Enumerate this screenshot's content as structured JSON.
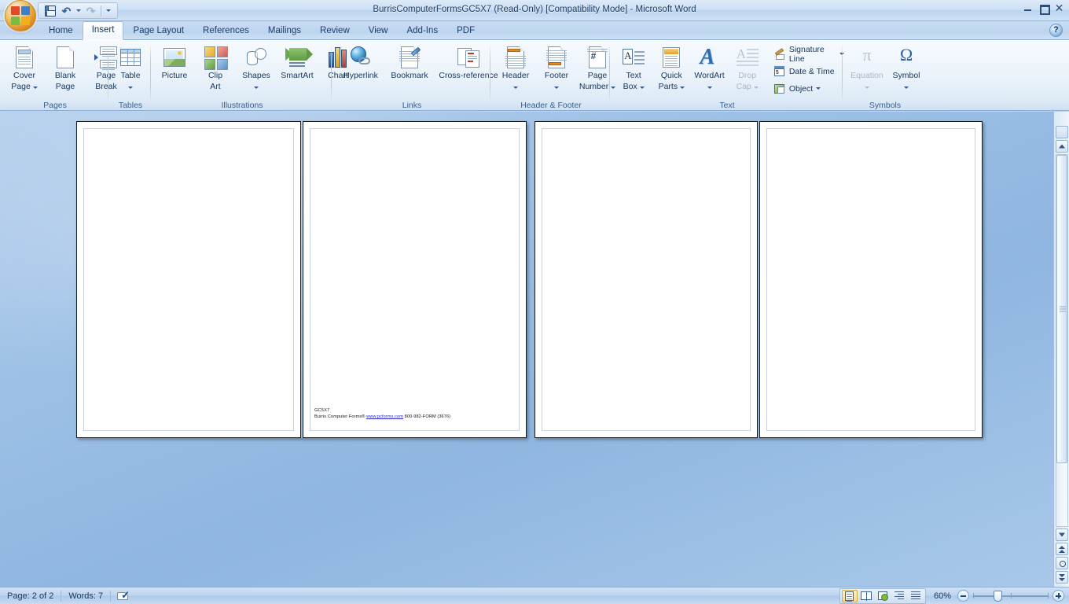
{
  "window": {
    "title": "BurrisComputerFormsGC5X7 (Read-Only) [Compatibility Mode] - Microsoft Word",
    "minimize": "Minimize",
    "maximize": "Restore Down",
    "close": "Close"
  },
  "quick_access": {
    "office_button": "Office Button",
    "save": "Save",
    "undo": "Undo",
    "redo": "Redo",
    "customize": "Customize Quick Access Toolbar"
  },
  "tabs": [
    {
      "label": "Home",
      "active": false
    },
    {
      "label": "Insert",
      "active": true
    },
    {
      "label": "Page Layout",
      "active": false
    },
    {
      "label": "References",
      "active": false
    },
    {
      "label": "Mailings",
      "active": false
    },
    {
      "label": "Review",
      "active": false
    },
    {
      "label": "View",
      "active": false
    },
    {
      "label": "Add-Ins",
      "active": false
    },
    {
      "label": "PDF",
      "active": false
    }
  ],
  "help": {
    "label": "?"
  },
  "ribbon": {
    "groups": [
      {
        "name": "Pages",
        "label": "Pages",
        "buttons": [
          {
            "label": "Cover\nPage",
            "line1": "Cover",
            "line2": "Page",
            "dropdown": true,
            "disabled": false
          },
          {
            "label": "Blank\nPage",
            "line1": "Blank",
            "line2": "Page",
            "dropdown": false,
            "disabled": false
          },
          {
            "label": "Page\nBreak",
            "line1": "Page",
            "line2": "Break",
            "dropdown": false,
            "disabled": false
          }
        ]
      },
      {
        "name": "Tables",
        "label": "Tables",
        "buttons": [
          {
            "label": "Table",
            "line1": "Table",
            "line2": "",
            "dropdown": true,
            "disabled": false
          }
        ]
      },
      {
        "name": "Illustrations",
        "label": "Illustrations",
        "buttons": [
          {
            "label": "Picture",
            "line1": "Picture",
            "line2": "",
            "dropdown": false,
            "disabled": false
          },
          {
            "label": "Clip Art",
            "line1": "Clip",
            "line2": "Art",
            "dropdown": false,
            "disabled": false
          },
          {
            "label": "Shapes",
            "line1": "Shapes",
            "line2": "",
            "dropdown": true,
            "disabled": false
          },
          {
            "label": "SmartArt",
            "line1": "SmartArt",
            "line2": "",
            "dropdown": false,
            "disabled": false
          },
          {
            "label": "Chart",
            "line1": "Chart",
            "line2": "",
            "dropdown": false,
            "disabled": false
          }
        ]
      },
      {
        "name": "Links",
        "label": "Links",
        "buttons": [
          {
            "label": "Hyperlink",
            "line1": "Hyperlink",
            "line2": "",
            "dropdown": false,
            "disabled": false
          },
          {
            "label": "Bookmark",
            "line1": "Bookmark",
            "line2": "",
            "dropdown": false,
            "disabled": false
          },
          {
            "label": "Cross-reference",
            "line1": "Cross-reference",
            "line2": "",
            "dropdown": false,
            "disabled": false
          }
        ]
      },
      {
        "name": "Header & Footer",
        "label": "Header & Footer",
        "buttons": [
          {
            "label": "Header",
            "line1": "Header",
            "line2": "",
            "dropdown": true,
            "disabled": false
          },
          {
            "label": "Footer",
            "line1": "Footer",
            "line2": "",
            "dropdown": true,
            "disabled": false
          },
          {
            "label": "Page Number",
            "line1": "Page",
            "line2": "Number",
            "dropdown": true,
            "disabled": false
          }
        ]
      },
      {
        "name": "Text",
        "label": "Text",
        "buttons": [
          {
            "label": "Text Box",
            "line1": "Text",
            "line2": "Box",
            "dropdown": true,
            "disabled": false
          },
          {
            "label": "Quick Parts",
            "line1": "Quick",
            "line2": "Parts",
            "dropdown": true,
            "disabled": false
          },
          {
            "label": "WordArt",
            "line1": "WordArt",
            "line2": "",
            "dropdown": true,
            "disabled": false
          },
          {
            "label": "Drop Cap",
            "line1": "Drop",
            "line2": "Cap",
            "dropdown": true,
            "disabled": true
          }
        ],
        "small_buttons": [
          {
            "label": "Signature Line",
            "dropdown": true
          },
          {
            "label": "Date & Time",
            "dropdown": false
          },
          {
            "label": "Object",
            "dropdown": true
          }
        ]
      },
      {
        "name": "Symbols",
        "label": "Symbols",
        "buttons": [
          {
            "label": "Equation",
            "line1": "Equation",
            "line2": "",
            "dropdown": true,
            "disabled": true,
            "glyph": "π"
          },
          {
            "label": "Symbol",
            "line1": "Symbol",
            "line2": "",
            "dropdown": true,
            "disabled": false,
            "glyph": "Ω"
          }
        ]
      }
    ]
  },
  "document": {
    "page_text": {
      "line1": "GC5X7",
      "line2_pre": "Burris Computer Forms® ",
      "line2_link": "www.pcforms.com",
      "line2_post": " 800-982-FORM (3676)"
    },
    "pages": [
      {
        "index": 1,
        "name": "document-page-1"
      },
      {
        "index": 2,
        "name": "document-page-2"
      },
      {
        "index": 3,
        "name": "document-page-3"
      },
      {
        "index": 4,
        "name": "document-page-4"
      }
    ]
  },
  "scrollbar": {
    "split_handle": "Split",
    "scroll_up": "Scroll Up",
    "scroll_down": "Scroll Down",
    "previous_page": "Previous Page",
    "select_browse_object": "Select Browse Object",
    "next_page": "Next Page"
  },
  "status_bar": {
    "page": "Page: 2 of 2",
    "words": "Words: 7",
    "proofing": "Proofing errors check",
    "views": [
      {
        "name": "print-layout",
        "label": "Print Layout",
        "active": true
      },
      {
        "name": "full-screen-reading",
        "label": "Full Screen Reading",
        "active": false
      },
      {
        "name": "web-layout",
        "label": "Web Layout",
        "active": false
      },
      {
        "name": "outline",
        "label": "Outline",
        "active": false
      },
      {
        "name": "draft",
        "label": "Draft",
        "active": false
      }
    ],
    "zoom_level": "60%",
    "zoom_out": "Zoom Out",
    "zoom_in": "Zoom In"
  },
  "colors": {
    "accent": "#1f3a63",
    "ribbon_bg": "#eaf2fa",
    "title_bg": "#cde0f4",
    "doc_bg": "#9ec1e6",
    "link": "#2020cc"
  }
}
